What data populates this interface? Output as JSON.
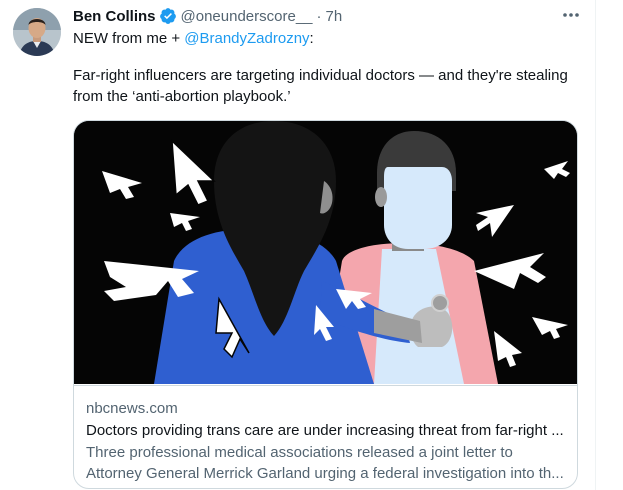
{
  "tweet": {
    "author_name": "Ben Collins",
    "author_handle": "@oneunderscore__",
    "separator": "·",
    "time": "7h",
    "line1_prefix": "NEW from me + ",
    "mention": "@BrandyZadrozny",
    "line1_suffix": ":",
    "body_line1": "Far-right influencers are targeting individual doctors — and they're stealing",
    "body_line2": "from the ‘anti-abortion playbook.’"
  },
  "card": {
    "domain": "nbcnews.com",
    "title": "Doctors providing trans care are under increasing threat from far-right ...",
    "description_line1": "Three professional medical associations released a joint letter to",
    "description_line2": "Attorney General Merrick Garland urging a federal investigation into th..."
  },
  "colors": {
    "link_blue": "#1d9bf0",
    "verified_blue": "#1d9bf0",
    "secondary_text": "#536471",
    "card_border": "#cfd9de",
    "illustration_bg": "#050505",
    "scrub_blue": "#2f5fd0",
    "scrub_pink": "#f4a6ad",
    "face_blue": "#d6e9fb"
  },
  "icons": [
    "verified-badge-icon",
    "more-options-icon"
  ]
}
